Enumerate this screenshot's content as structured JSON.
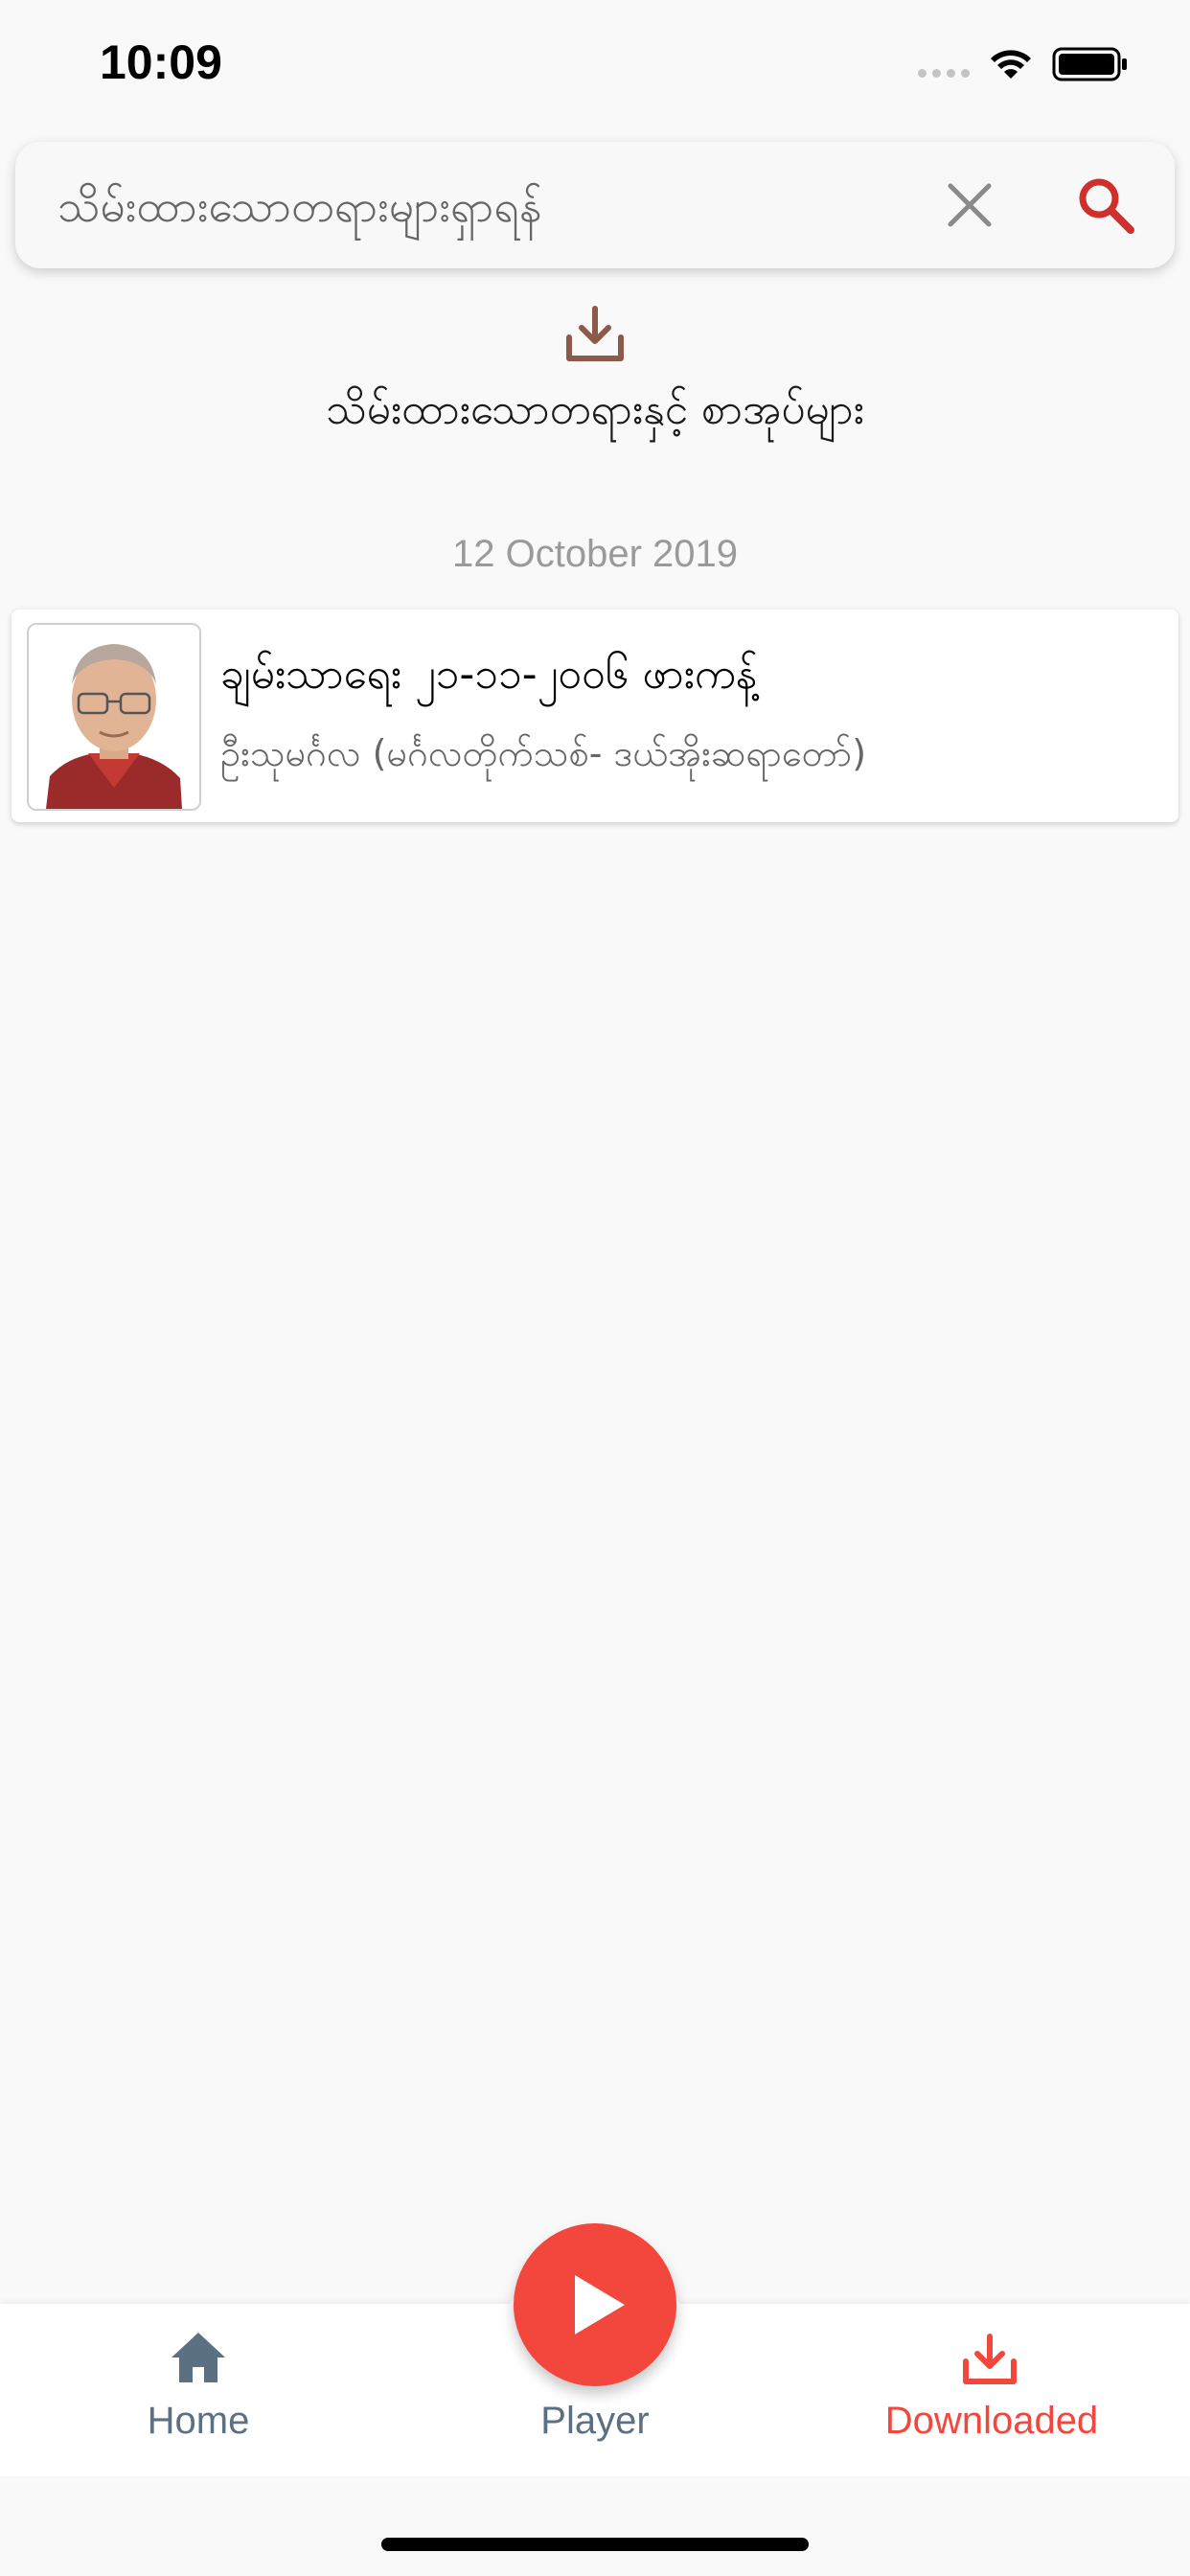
{
  "status_bar": {
    "time": "10:09"
  },
  "search": {
    "placeholder": "သိမ်းထားသောတရားများရှာရန်",
    "value": ""
  },
  "header": {
    "title": "သိမ်းထားသောတရားနှင့် စာအုပ်များ"
  },
  "sections": [
    {
      "date": "12 October 2019",
      "items": [
        {
          "title": "ချမ်းသာရေး ၂၁-၁၁-၂၀၀၆ ဖားကန့်",
          "subtitle": "ဦးသုမင်္ဂလ (မင်္ဂလတိုက်သစ်- ဒယ်အိုးဆရာတော်)"
        }
      ]
    }
  ],
  "tabs": {
    "home": "Home",
    "player": "Player",
    "downloaded": "Downloaded"
  },
  "colors": {
    "accent_red": "#f3463c",
    "tab_inactive": "#5b7083",
    "header_icon": "#8b5a4a"
  },
  "icons": {
    "search": "search-icon",
    "clear": "close-icon",
    "download": "download-icon",
    "home": "home-icon",
    "play": "play-icon"
  }
}
